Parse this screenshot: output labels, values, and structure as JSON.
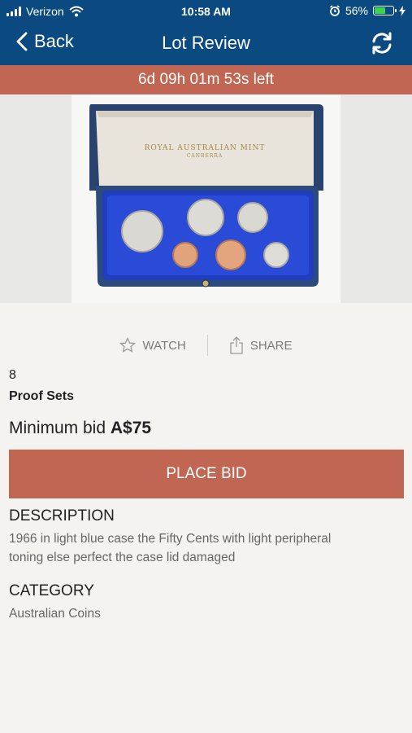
{
  "status_bar": {
    "carrier": "Verizon",
    "time": "10:58 AM",
    "battery_percent": "56%",
    "battery_level": 0.56
  },
  "nav": {
    "back_label": "Back",
    "title": "Lot Review",
    "refresh_icon": "refresh-icon"
  },
  "timer": {
    "text": "6d 09h 01m 53s left",
    "color": "#c16652"
  },
  "actions": {
    "watch_label": "WATCH",
    "share_label": "SHARE"
  },
  "lot": {
    "number": "8",
    "title": "Proof Sets",
    "min_bid_label": "Minimum bid",
    "min_bid_value": "A$75"
  },
  "bid_button": {
    "label": "PLACE BID"
  },
  "description": {
    "heading": "DESCRIPTION",
    "text_line1": "1966 in light blue case  the Fifty Cents with light peripheral",
    "text_line2": "toning else perfect  the case lid damaged"
  },
  "category": {
    "heading": "CATEGORY",
    "text": "Australian Coins"
  },
  "photo": {
    "lid_line1": "ROYAL AUSTRALIAN MINT",
    "lid_line2": "CANBERRA"
  },
  "colors": {
    "header": "#0b4a80",
    "accent": "#c16652"
  }
}
